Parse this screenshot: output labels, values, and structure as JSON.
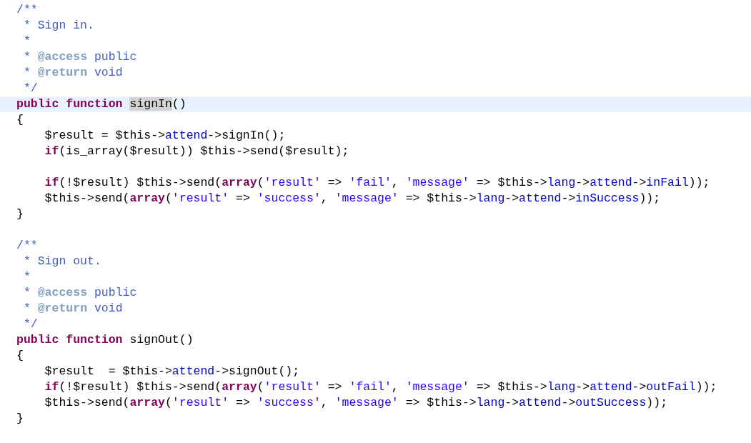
{
  "editor": {
    "lines": [
      {
        "current": false,
        "tokens": [
          {
            "kind": "doc",
            "text": "/**"
          }
        ]
      },
      {
        "current": false,
        "tokens": [
          {
            "kind": "doc",
            "text": " * Sign in."
          }
        ]
      },
      {
        "current": false,
        "tokens": [
          {
            "kind": "doc",
            "text": " *"
          }
        ]
      },
      {
        "current": false,
        "tokens": [
          {
            "kind": "doc",
            "text": " * "
          },
          {
            "kind": "tag",
            "text": "@access"
          },
          {
            "kind": "doc",
            "text": " public"
          }
        ]
      },
      {
        "current": false,
        "tokens": [
          {
            "kind": "doc",
            "text": " * "
          },
          {
            "kind": "tag",
            "text": "@return"
          },
          {
            "kind": "doc",
            "text": " void"
          }
        ]
      },
      {
        "current": false,
        "tokens": [
          {
            "kind": "doc",
            "text": " */"
          }
        ]
      },
      {
        "current": true,
        "tokens": [
          {
            "kind": "keyword",
            "text": "public ",
            "marked": false
          },
          {
            "kind": "keyword",
            "text": "function ",
            "marked": false
          },
          {
            "kind": "plain",
            "text": "signIn",
            "marked": true
          },
          {
            "kind": "plain",
            "text": "()",
            "marked": false
          }
        ]
      },
      {
        "current": false,
        "tokens": [
          {
            "kind": "plain",
            "text": "{"
          }
        ]
      },
      {
        "current": false,
        "tokens": [
          {
            "kind": "plain",
            "text": "    $result = $this->"
          },
          {
            "kind": "field",
            "text": "attend"
          },
          {
            "kind": "plain",
            "text": "->signIn();"
          }
        ]
      },
      {
        "current": false,
        "tokens": [
          {
            "kind": "keyword",
            "text": "    if"
          },
          {
            "kind": "plain",
            "text": "(is_array($result)) $this->send($result);"
          }
        ]
      },
      {
        "current": false
      },
      {
        "current": false,
        "tokens": [
          {
            "kind": "keyword",
            "text": "    if"
          },
          {
            "kind": "plain",
            "text": "(!$result) $this->send("
          },
          {
            "kind": "keyword",
            "text": "array"
          },
          {
            "kind": "plain",
            "text": "("
          },
          {
            "kind": "string",
            "text": "'result'"
          },
          {
            "kind": "plain",
            "text": " => "
          },
          {
            "kind": "string",
            "text": "'fail'"
          },
          {
            "kind": "plain",
            "text": ", "
          },
          {
            "kind": "string",
            "text": "'message'"
          },
          {
            "kind": "plain",
            "text": " => $this->"
          },
          {
            "kind": "field",
            "text": "lang"
          },
          {
            "kind": "plain",
            "text": "->"
          },
          {
            "kind": "field",
            "text": "attend"
          },
          {
            "kind": "plain",
            "text": "->"
          },
          {
            "kind": "field",
            "text": "inFail"
          },
          {
            "kind": "plain",
            "text": "));"
          }
        ]
      },
      {
        "current": false,
        "tokens": [
          {
            "kind": "plain",
            "text": "    $this->send("
          },
          {
            "kind": "keyword",
            "text": "array"
          },
          {
            "kind": "plain",
            "text": "("
          },
          {
            "kind": "string",
            "text": "'result'"
          },
          {
            "kind": "plain",
            "text": " => "
          },
          {
            "kind": "string",
            "text": "'success'"
          },
          {
            "kind": "plain",
            "text": ", "
          },
          {
            "kind": "string",
            "text": "'message'"
          },
          {
            "kind": "plain",
            "text": " => $this->"
          },
          {
            "kind": "field",
            "text": "lang"
          },
          {
            "kind": "plain",
            "text": "->"
          },
          {
            "kind": "field",
            "text": "attend"
          },
          {
            "kind": "plain",
            "text": "->"
          },
          {
            "kind": "field",
            "text": "inSuccess"
          },
          {
            "kind": "plain",
            "text": "));"
          }
        ]
      },
      {
        "current": false,
        "tokens": [
          {
            "kind": "plain",
            "text": "}"
          }
        ]
      },
      {
        "current": false
      },
      {
        "current": false,
        "tokens": [
          {
            "kind": "doc",
            "text": "/**"
          }
        ]
      },
      {
        "current": false,
        "tokens": [
          {
            "kind": "doc",
            "text": " * Sign out."
          }
        ]
      },
      {
        "current": false,
        "tokens": [
          {
            "kind": "doc",
            "text": " *"
          }
        ]
      },
      {
        "current": false,
        "tokens": [
          {
            "kind": "doc",
            "text": " * "
          },
          {
            "kind": "tag",
            "text": "@access"
          },
          {
            "kind": "doc",
            "text": " public"
          }
        ]
      },
      {
        "current": false,
        "tokens": [
          {
            "kind": "doc",
            "text": " * "
          },
          {
            "kind": "tag",
            "text": "@return"
          },
          {
            "kind": "doc",
            "text": " void"
          }
        ]
      },
      {
        "current": false,
        "tokens": [
          {
            "kind": "doc",
            "text": " */"
          }
        ]
      },
      {
        "current": false,
        "tokens": [
          {
            "kind": "keyword",
            "text": "public "
          },
          {
            "kind": "keyword",
            "text": "function "
          },
          {
            "kind": "plain",
            "text": "signOut()"
          }
        ]
      },
      {
        "current": false,
        "tokens": [
          {
            "kind": "plain",
            "text": "{"
          }
        ]
      },
      {
        "current": false,
        "tokens": [
          {
            "kind": "plain",
            "text": "    $result  = $this->"
          },
          {
            "kind": "field",
            "text": "attend"
          },
          {
            "kind": "plain",
            "text": "->signOut();"
          }
        ]
      },
      {
        "current": false,
        "tokens": [
          {
            "kind": "keyword",
            "text": "    if"
          },
          {
            "kind": "plain",
            "text": "(!$result) $this->send("
          },
          {
            "kind": "keyword",
            "text": "array"
          },
          {
            "kind": "plain",
            "text": "("
          },
          {
            "kind": "string",
            "text": "'result'"
          },
          {
            "kind": "plain",
            "text": " => "
          },
          {
            "kind": "string",
            "text": "'fail'"
          },
          {
            "kind": "plain",
            "text": ", "
          },
          {
            "kind": "string",
            "text": "'message'"
          },
          {
            "kind": "plain",
            "text": " => $this->"
          },
          {
            "kind": "field",
            "text": "lang"
          },
          {
            "kind": "plain",
            "text": "->"
          },
          {
            "kind": "field",
            "text": "attend"
          },
          {
            "kind": "plain",
            "text": "->"
          },
          {
            "kind": "field",
            "text": "outFail"
          },
          {
            "kind": "plain",
            "text": "));"
          }
        ]
      },
      {
        "current": false,
        "tokens": [
          {
            "kind": "plain",
            "text": "    $this->send("
          },
          {
            "kind": "keyword",
            "text": "array"
          },
          {
            "kind": "plain",
            "text": "("
          },
          {
            "kind": "string",
            "text": "'result'"
          },
          {
            "kind": "plain",
            "text": " => "
          },
          {
            "kind": "string",
            "text": "'success'"
          },
          {
            "kind": "plain",
            "text": ", "
          },
          {
            "kind": "string",
            "text": "'message'"
          },
          {
            "kind": "plain",
            "text": " => $this->"
          },
          {
            "kind": "field",
            "text": "lang"
          },
          {
            "kind": "plain",
            "text": "->"
          },
          {
            "kind": "field",
            "text": "attend"
          },
          {
            "kind": "plain",
            "text": "->"
          },
          {
            "kind": "field",
            "text": "outSuccess"
          },
          {
            "kind": "plain",
            "text": "));"
          }
        ]
      },
      {
        "current": false,
        "tokens": [
          {
            "kind": "plain",
            "text": "}"
          }
        ]
      }
    ]
  }
}
